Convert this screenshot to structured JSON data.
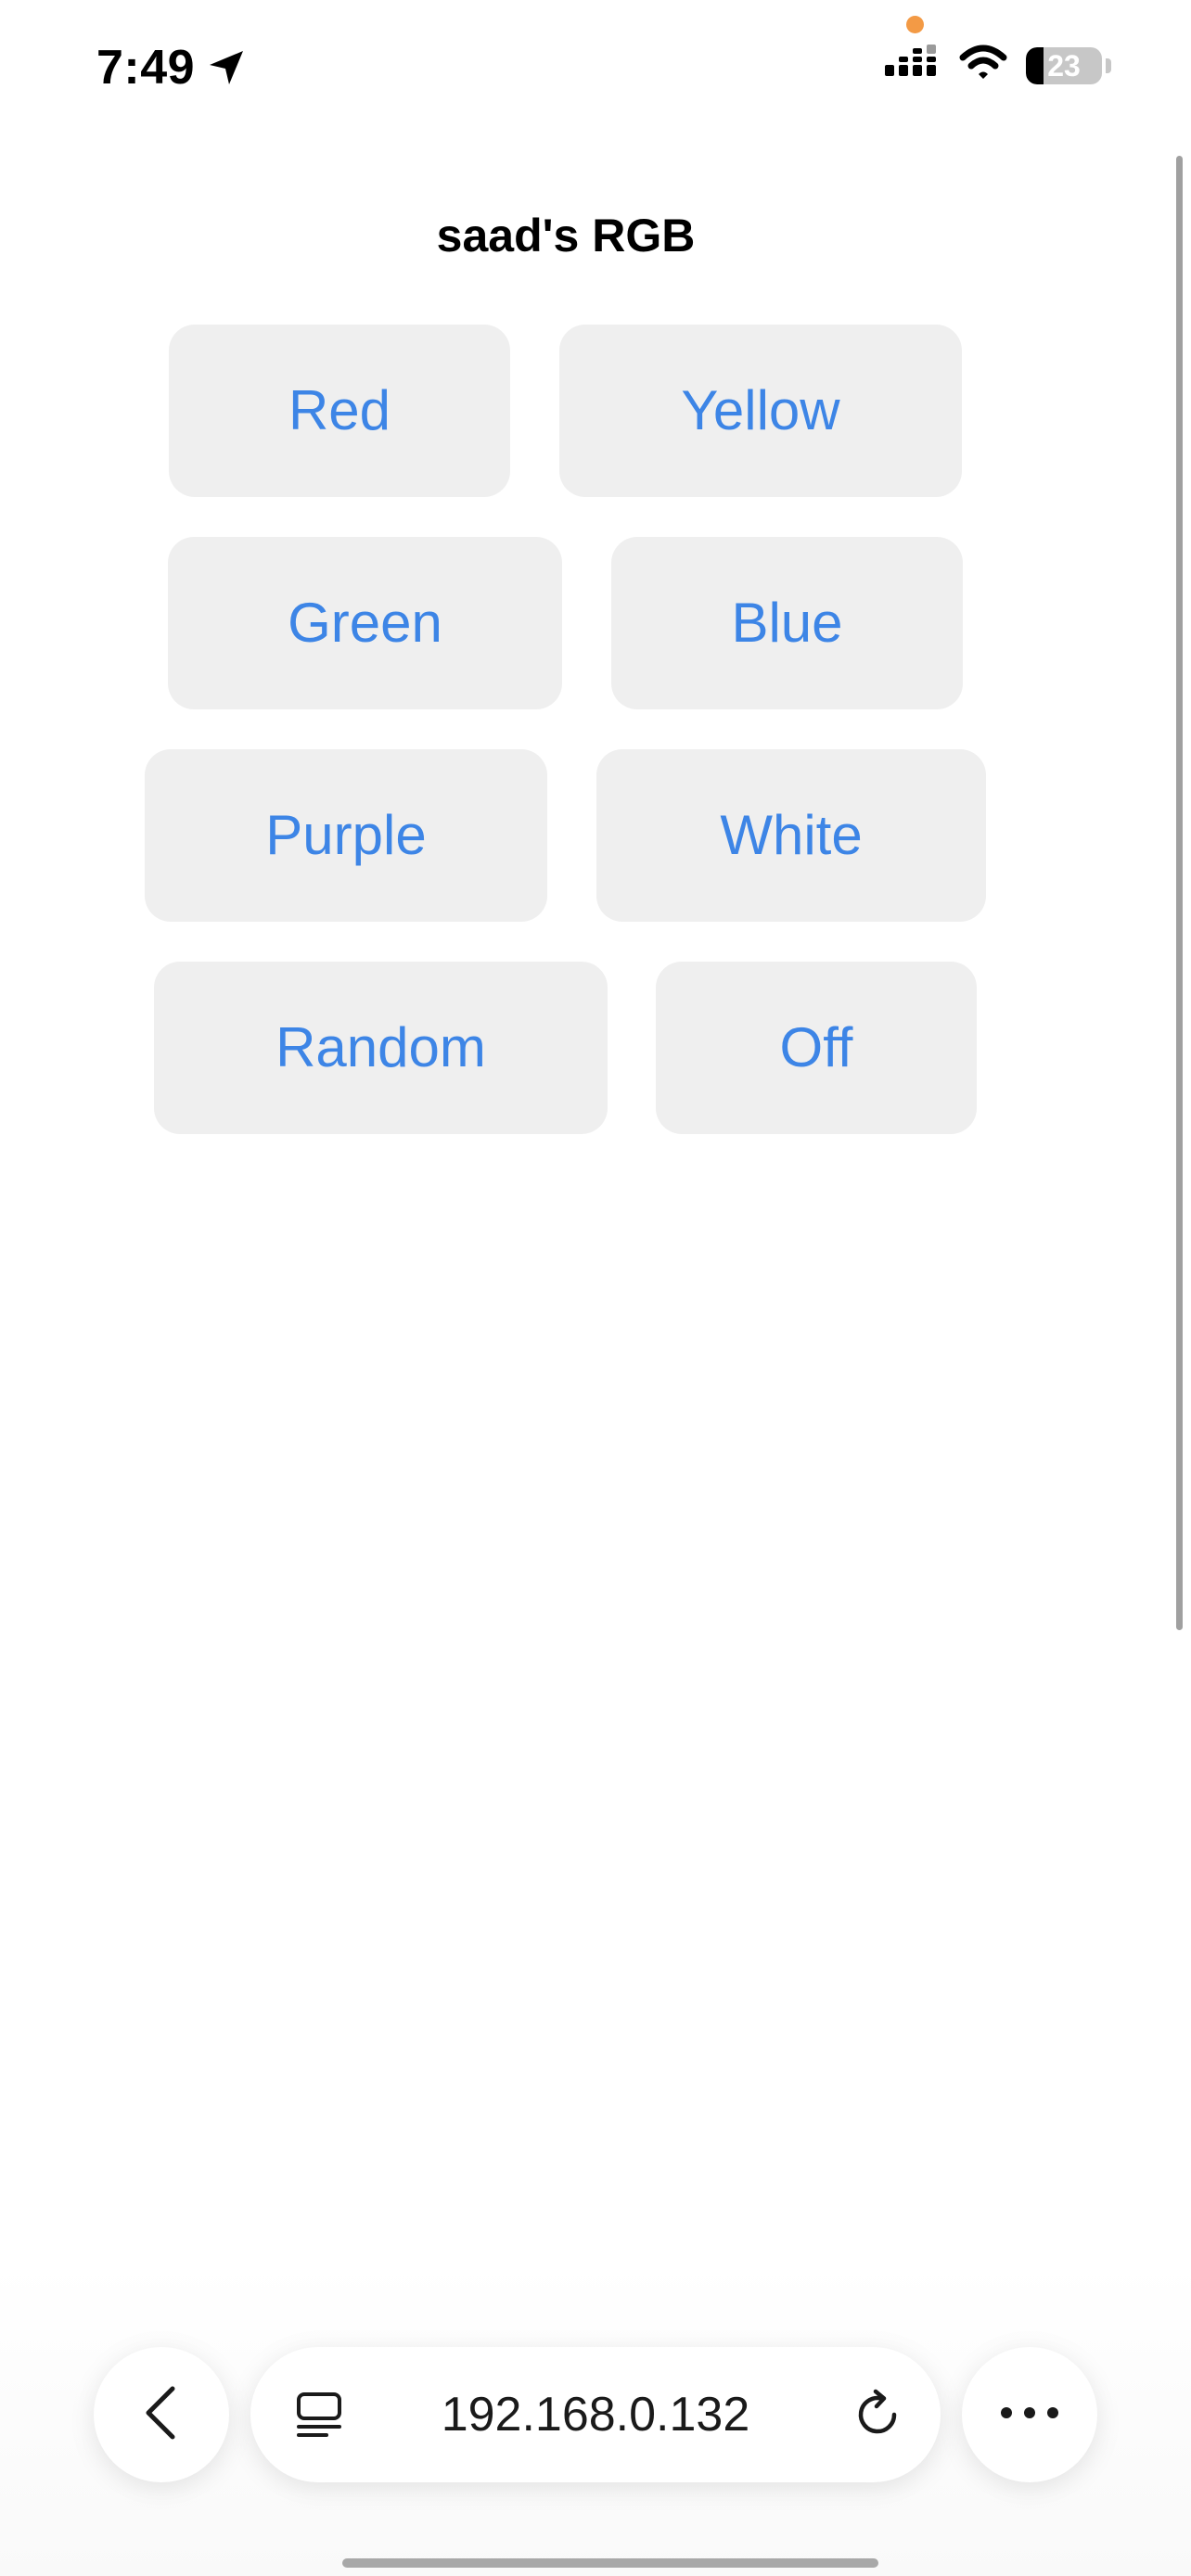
{
  "status_bar": {
    "time": "7:49",
    "battery_level": "23",
    "battery_fraction": 0.23,
    "privacy_indicator_color": "#f39a45",
    "icons": [
      "location-arrow-icon",
      "cellular-signal-icon",
      "wifi-icon",
      "battery-icon"
    ]
  },
  "page": {
    "title": "saad's RGB",
    "buttons": {
      "red": "Red",
      "yellow": "Yellow",
      "green": "Green",
      "blue": "Blue",
      "purple": "Purple",
      "white": "White",
      "random": "Random",
      "off": "Off"
    },
    "button_text_color": "#3d85e6",
    "button_background": "#efefef"
  },
  "browser_toolbar": {
    "address": "192.168.0.132",
    "icons": [
      "back-chevron-icon",
      "tabs-icon",
      "reload-icon",
      "more-icon"
    ]
  }
}
